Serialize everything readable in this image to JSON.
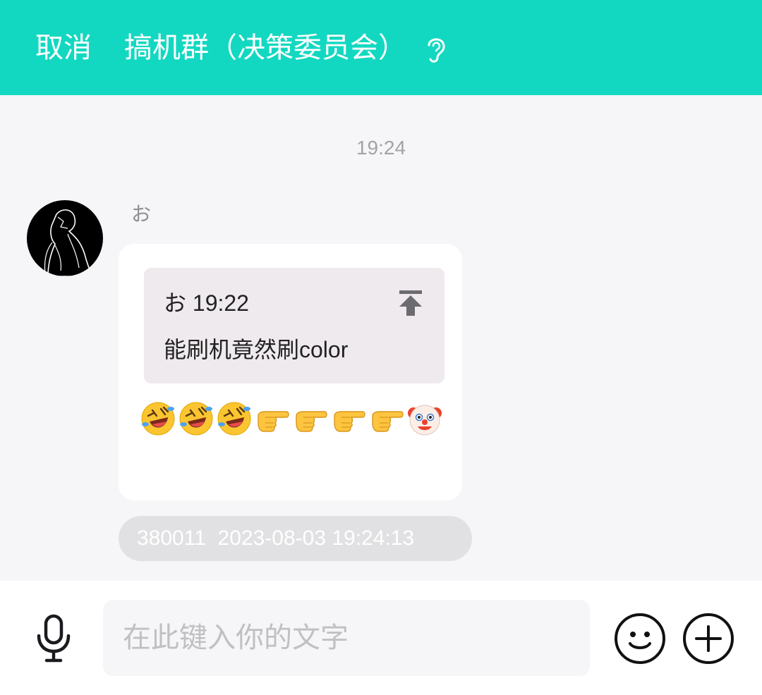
{
  "header": {
    "cancel_label": "取消",
    "title": "搞机群（决策委员会）",
    "ear_icon": "ear-icon",
    "background_color": "#13d8c1"
  },
  "chat": {
    "timestamp": "19:24",
    "message": {
      "sender_name": "お",
      "avatar_icon": "avatar-silhouette",
      "quote": {
        "header": "お 19:22",
        "text": "能刷机竟然刷color",
        "pin_icon": "pin-to-top-icon"
      },
      "emojis": [
        "🤣",
        "🤣",
        "🤣",
        "👉",
        "👉",
        "👉",
        "👉",
        "🤡"
      ],
      "meta": {
        "id": "380011",
        "datetime": "2023-08-03 19:24:13",
        "full": "380011  2023-08-03 19:24:13"
      }
    }
  },
  "composer": {
    "placeholder": "在此键入你的文字",
    "mic_icon": "microphone-icon",
    "emoji_icon": "smile-icon",
    "plus_icon": "plus-icon"
  }
}
